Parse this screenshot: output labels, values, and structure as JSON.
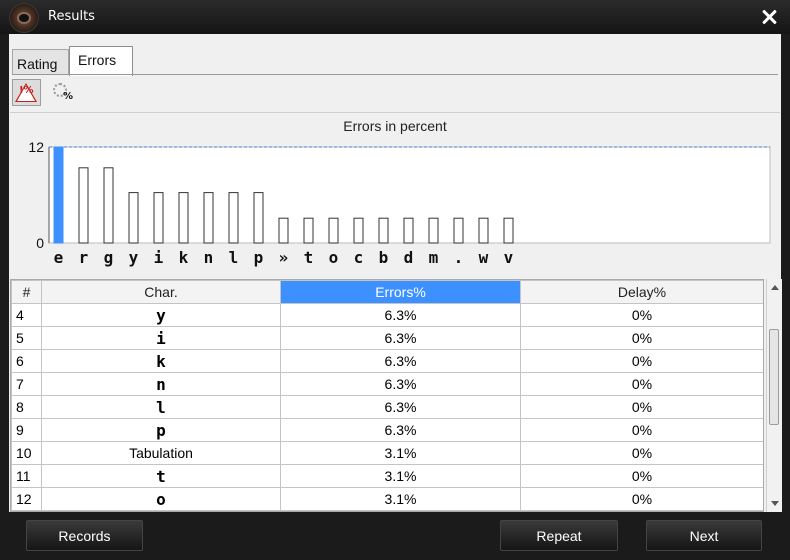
{
  "window": {
    "title": "Results"
  },
  "tabs": [
    {
      "label": "Rating",
      "active": false
    },
    {
      "label": "Errors",
      "active": true
    }
  ],
  "toolbar": {
    "errors_icon": "warning-percent-icon",
    "delay_icon": "spinner-percent-icon"
  },
  "chart_data": {
    "type": "bar",
    "title": "Errors in percent",
    "categories": [
      "e",
      "r",
      "g",
      "y",
      "i",
      "k",
      "n",
      "l",
      "p",
      "»",
      "t",
      "o",
      "c",
      "b",
      "d",
      "m",
      ".",
      "w",
      "v"
    ],
    "values": [
      12.5,
      9.4,
      9.4,
      6.3,
      6.3,
      6.3,
      6.3,
      6.3,
      6.3,
      3.1,
      3.1,
      3.1,
      3.1,
      3.1,
      3.1,
      3.1,
      3.1,
      3.1,
      3.1
    ],
    "highlight_index": 0,
    "ylim": [
      0,
      12
    ],
    "yticks": [
      "0",
      "12"
    ],
    "grid": false,
    "colors": {
      "highlight": "#3d90ff",
      "normal": "#ffffff",
      "outline": "#333333"
    }
  },
  "table": {
    "headers": [
      "#",
      "Char.",
      "Errors%",
      "Delay%"
    ],
    "active_header": 2,
    "rows": [
      {
        "num": "4",
        "char": "y",
        "mono": true,
        "errors": "6.3%",
        "delay": "0%"
      },
      {
        "num": "5",
        "char": "i",
        "mono": true,
        "errors": "6.3%",
        "delay": "0%"
      },
      {
        "num": "6",
        "char": "k",
        "mono": true,
        "errors": "6.3%",
        "delay": "0%"
      },
      {
        "num": "7",
        "char": "n",
        "mono": true,
        "errors": "6.3%",
        "delay": "0%"
      },
      {
        "num": "8",
        "char": "l",
        "mono": true,
        "errors": "6.3%",
        "delay": "0%"
      },
      {
        "num": "9",
        "char": "p",
        "mono": true,
        "errors": "6.3%",
        "delay": "0%"
      },
      {
        "num": "10",
        "char": "Tabulation",
        "mono": false,
        "errors": "3.1%",
        "delay": "0%"
      },
      {
        "num": "11",
        "char": "t",
        "mono": true,
        "errors": "3.1%",
        "delay": "0%"
      },
      {
        "num": "12",
        "char": "o",
        "mono": true,
        "errors": "3.1%",
        "delay": "0%"
      }
    ]
  },
  "buttons": {
    "records": "Records",
    "repeat": "Repeat",
    "next": "Next"
  }
}
